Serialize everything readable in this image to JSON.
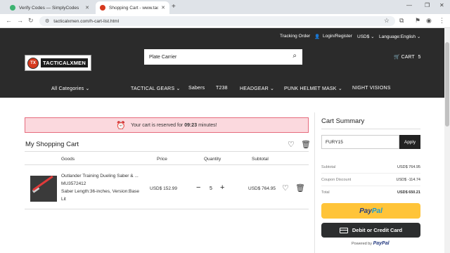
{
  "browser": {
    "tabs": [
      {
        "title": "Verify Codes — SimplyCodes",
        "icon": "check-circle-icon"
      },
      {
        "title": "Shopping Cart - www.tacticalm",
        "icon": "site-favicon"
      }
    ],
    "url": "tacticalxmen.com/h-cart-list.html"
  },
  "header": {
    "tracking_order": "Tracking Order",
    "login_register": "Login/Register",
    "currency": "USD$",
    "language": "Language:English",
    "logo_text": "TACTICALXMEN",
    "search_value": "Plate Carrier",
    "cart_label": "CART",
    "cart_count": "5"
  },
  "nav": {
    "items": [
      "All Categories",
      "TACTICAL GEARS",
      "Sabers",
      "T238",
      "HEADGEAR",
      "PUNK HELMET MASK",
      "NIGHT VISIONS"
    ]
  },
  "notice": {
    "before": "Your cart is reserved for",
    "time": "09:23",
    "after": "minutes!"
  },
  "cart": {
    "title": "My Shopping Cart",
    "columns": [
      "Goods",
      "Price",
      "Quantity",
      "Subtotal"
    ],
    "items": [
      {
        "name": "Outlander Training Dueling Saber & ...",
        "sku": "MU3572412",
        "options_line1": "Saber Length:36-inches, Version:Base",
        "options_line2": "Lit",
        "price": "USD$ 152.99",
        "quantity": "5",
        "subtotal": "USD$ 764.95"
      }
    ]
  },
  "summary": {
    "title": "Cart Summary",
    "coupon_value": "FURY15",
    "apply_label": "Apply",
    "subtotal_label": "Subtotal",
    "subtotal_value": "USD$ 764.95",
    "discount_label": "Coupon Discount",
    "discount_value": "USD$ -114.74",
    "total_label": "Total",
    "total_value": "USD$ 650.21",
    "paypal_part1": "Pay",
    "paypal_part2": "Pal",
    "card_label": "Debit or Credit Card",
    "powered_by": "Powered by",
    "powered_brand": "PayPal"
  },
  "colors": {
    "header_bg": "#2b2b2b",
    "notice_bg": "#fbd9de",
    "notice_border": "#e66b7d",
    "paypal_yellow": "#ffc439",
    "card_button": "#2c2e2f"
  }
}
